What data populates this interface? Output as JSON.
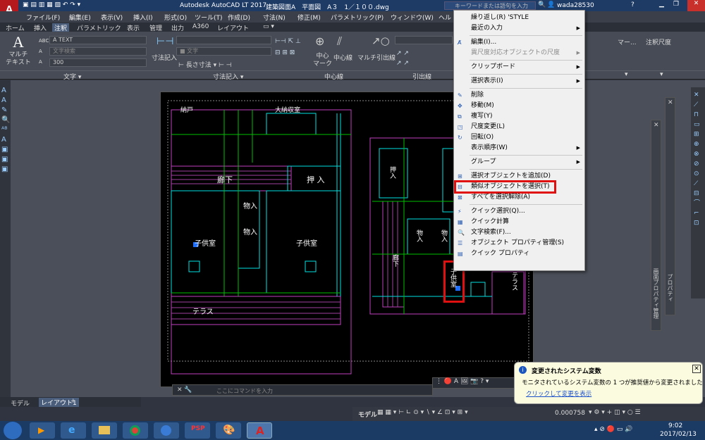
{
  "title_bar": {
    "app_name": "Autodesk AutoCAD LT 2017",
    "doc_title": "建築図面A　平面図　A３　1／１００.dwg",
    "search_placeholder": "キーワードまたは語句を入力",
    "user": "wada28530"
  },
  "menu": [
    "ファイル(F)",
    "編集(E)",
    "表示(V)",
    "挿入(I)",
    "形式(O)",
    "ツール(T)",
    "作成(D)",
    "寸法(N)",
    "修正(M)",
    "パラメトリック(P)",
    "ウィンドウ(W)",
    "ヘル"
  ],
  "ribbon_tabs": [
    "ホーム",
    "挿入",
    "注釈",
    "パラメトリック",
    "表示",
    "管理",
    "出力",
    "A360",
    "レイアウト"
  ],
  "active_ribbon_tab": "注釈",
  "ribbon": {
    "text_group": {
      "big_button": "マルチ\nテキスト",
      "style_value": "TEXT",
      "search_placeholder": "文字検索",
      "height_value": "300",
      "panel_label": "文字 ▾"
    },
    "dim_group": {
      "button": "寸法記入",
      "layer_value": "文字",
      "sub_button": "長さ寸法",
      "panel_label": "寸法記入 ▾"
    },
    "centerline_group": {
      "center_mark": "中心\nマーク",
      "centerline": "中心線",
      "panel_label": "中心線"
    },
    "leader_group": {
      "multi_leader": "マルチ引出線",
      "panel_label": "引出線"
    },
    "right_labels": [
      "マー...",
      "注釈尺度"
    ]
  },
  "context_menu": {
    "items": [
      {
        "label": "繰り返し(R) 'STYLE",
        "submenu": false,
        "disabled": false,
        "icon": ""
      },
      {
        "label": "最近の入力",
        "submenu": true,
        "disabled": false,
        "icon": ""
      },
      {
        "sep": true
      },
      {
        "label": "編集(I)...",
        "submenu": false,
        "disabled": false,
        "icon": "text-edit-icon"
      },
      {
        "label": "異尺度対応オブジェクトの尺度",
        "submenu": true,
        "disabled": true,
        "icon": ""
      },
      {
        "sep": true
      },
      {
        "label": "クリップボード",
        "submenu": true,
        "disabled": false,
        "icon": ""
      },
      {
        "sep": true
      },
      {
        "label": "選択表示(I)",
        "submenu": true,
        "disabled": false,
        "icon": ""
      },
      {
        "sep": true
      },
      {
        "label": "削除",
        "submenu": false,
        "disabled": false,
        "icon": "erase-icon"
      },
      {
        "label": "移動(M)",
        "submenu": false,
        "disabled": false,
        "icon": "move-icon"
      },
      {
        "label": "複写(Y)",
        "submenu": false,
        "disabled": false,
        "icon": "copy-icon"
      },
      {
        "label": "尺度変更(L)",
        "submenu": false,
        "disabled": false,
        "icon": "scale-icon"
      },
      {
        "label": "回転(O)",
        "submenu": false,
        "disabled": false,
        "icon": "rotate-icon"
      },
      {
        "label": "表示順序(W)",
        "submenu": true,
        "disabled": false,
        "icon": ""
      },
      {
        "sep": true
      },
      {
        "label": "グループ",
        "submenu": true,
        "disabled": false,
        "icon": ""
      },
      {
        "sep": true
      },
      {
        "label": "選択オブジェクトを追加(D)",
        "submenu": false,
        "disabled": false,
        "icon": "add-selected-icon"
      },
      {
        "label": "類似オブジェクトを選択(T)",
        "submenu": false,
        "disabled": false,
        "icon": "select-similar-icon",
        "highlight": true
      },
      {
        "label": "すべてを選択解除(A)",
        "submenu": false,
        "disabled": false,
        "icon": "deselect-icon"
      },
      {
        "sep": true
      },
      {
        "label": "クイック選択(Q)...",
        "submenu": false,
        "disabled": false,
        "icon": "quick-select-icon"
      },
      {
        "label": "クイック計算",
        "submenu": false,
        "disabled": false,
        "icon": "calculator-icon"
      },
      {
        "label": "文字検索(F)...",
        "submenu": false,
        "disabled": false,
        "icon": "find-text-icon"
      },
      {
        "label": "オブジェクト プロパティ管理(S)",
        "submenu": false,
        "disabled": false,
        "icon": "properties-icon"
      },
      {
        "label": "クイック プロパティ",
        "submenu": false,
        "disabled": false,
        "icon": "quick-properties-icon"
      }
    ]
  },
  "drawing": {
    "rooms": [
      "廊下",
      "押 入",
      "物入",
      "物入",
      "子供室",
      "子供室",
      "テラス",
      "押入",
      "物入",
      "物入",
      "廊下",
      "子供室",
      "テラス"
    ],
    "top_partial": [
      "納戸",
      "大納収室"
    ]
  },
  "palette_labels": [
    "画面プロパティ管理",
    "プロパティ"
  ],
  "notification": {
    "title": "変更されたシステム変数",
    "body": "モニタされているシステム変数の 1 つが推奨値から変更されました",
    "link": "クリックして変更を表示"
  },
  "command_placeholder": "ここにコマンドを入力",
  "model_tabs": [
    "モデル",
    "レイアウト1"
  ],
  "status": {
    "mode": "モデル",
    "value": "0.000758"
  },
  "clock": {
    "time": "9:02",
    "date": "2017/02/13"
  },
  "colors": {
    "highlight_box": "#e01010",
    "accent": "#1e3b66"
  }
}
